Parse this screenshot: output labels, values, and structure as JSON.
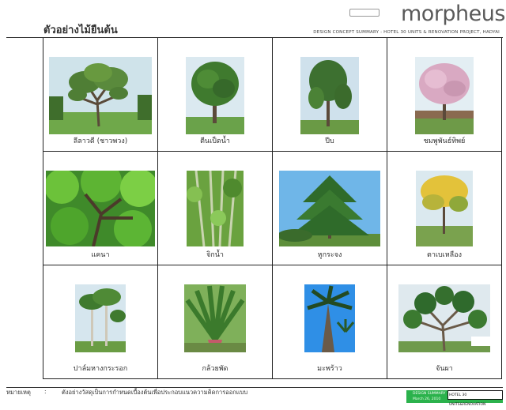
{
  "header": {
    "brand": "morpheus",
    "doc_title": "DESIGN CONCEPT SUMMARY : HOTEL 30 UNITS & RENOVATION PROJECT, HADYAI"
  },
  "page_title": "ตัวอย่างไม้ยืนต้น",
  "trees": [
    {
      "name": "ลีลาวดี (ชาวพวง)",
      "photo": "frangipani-tree"
    },
    {
      "name": "ตีนเป็ดน้ำ",
      "photo": "pong-pong-tree"
    },
    {
      "name": "ปีบ",
      "photo": "cork-tree"
    },
    {
      "name": "ชมพูพันธ์ทิพย์",
      "photo": "pink-trumpet-tree"
    },
    {
      "name": "แคนา",
      "photo": "dolichandrone-canopy"
    },
    {
      "name": "จิกน้ำ",
      "photo": "barringtonia-canopy"
    },
    {
      "name": "หูกระจง",
      "photo": "terminalia-tree"
    },
    {
      "name": "ตาเบเหลือง",
      "photo": "yellow-tabebuia-tree"
    },
    {
      "name": "ปาล์มหางกระรอก",
      "photo": "foxtail-palm"
    },
    {
      "name": "กล้วยพัด",
      "photo": "travellers-palm"
    },
    {
      "name": "มะพร้าว",
      "photo": "coconut-palm"
    },
    {
      "name": "จันผา",
      "photo": "dracaena-tree"
    }
  ],
  "remark": {
    "label": "หมายเหตุ",
    "colon": ":",
    "text": "ตังอย่างวัสดุเป็นการกำหนดเบื้องต้นเพื่อประกอบแนวความคิดการออกแบบ"
  },
  "footer": {
    "summary": "DESIGN SUMMARY",
    "date": "March 26, 2010",
    "project": "HOTEL 30 UNITS&RENOVATION"
  },
  "colors": {
    "footer_green": "#2bb24c",
    "grid_line": "#222222",
    "logo_gray": "#5a5a5a"
  }
}
